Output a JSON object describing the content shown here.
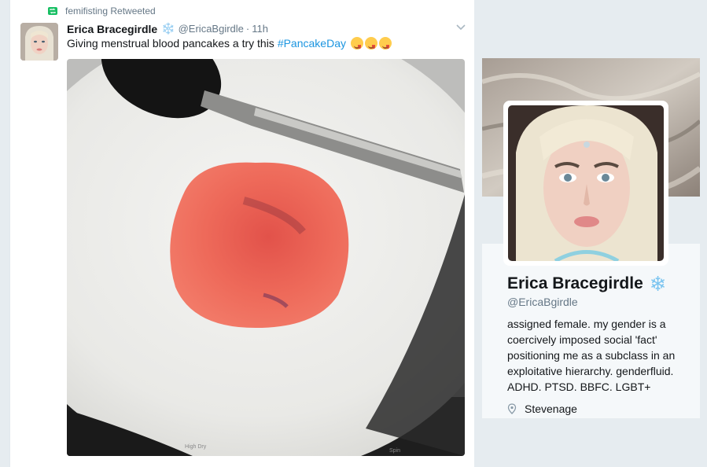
{
  "tweet": {
    "retweet_label": "femifisting Retweeted",
    "fullname": "Erica Bracegirdle",
    "badge": "❄️",
    "screen_name": "@EricaBgirdle",
    "separator": "·",
    "time": "11h",
    "text": "Giving menstrual blood pancakes a try this",
    "hashtag": "#PancakeDay",
    "emoji_count": 3,
    "icons": {
      "retweet": "retweet-icon",
      "caret": "chevron-down-icon"
    }
  },
  "profile": {
    "name": "Erica Bracegirdle",
    "badge": "❄",
    "handle": "@EricaBgirdle",
    "bio": "assigned female. my gender is a coercively imposed social 'fact' positioning me as a subclass in an exploitative hierarchy. genderfluid. ADHD. PTSD. BBFC. LGBT+",
    "location": "Stevenage",
    "location_icon": "map-pin-icon"
  },
  "colors": {
    "link": "#1b95e0",
    "muted": "#657786",
    "retweet_green": "#17bf63",
    "background": "#e6ecf0"
  }
}
